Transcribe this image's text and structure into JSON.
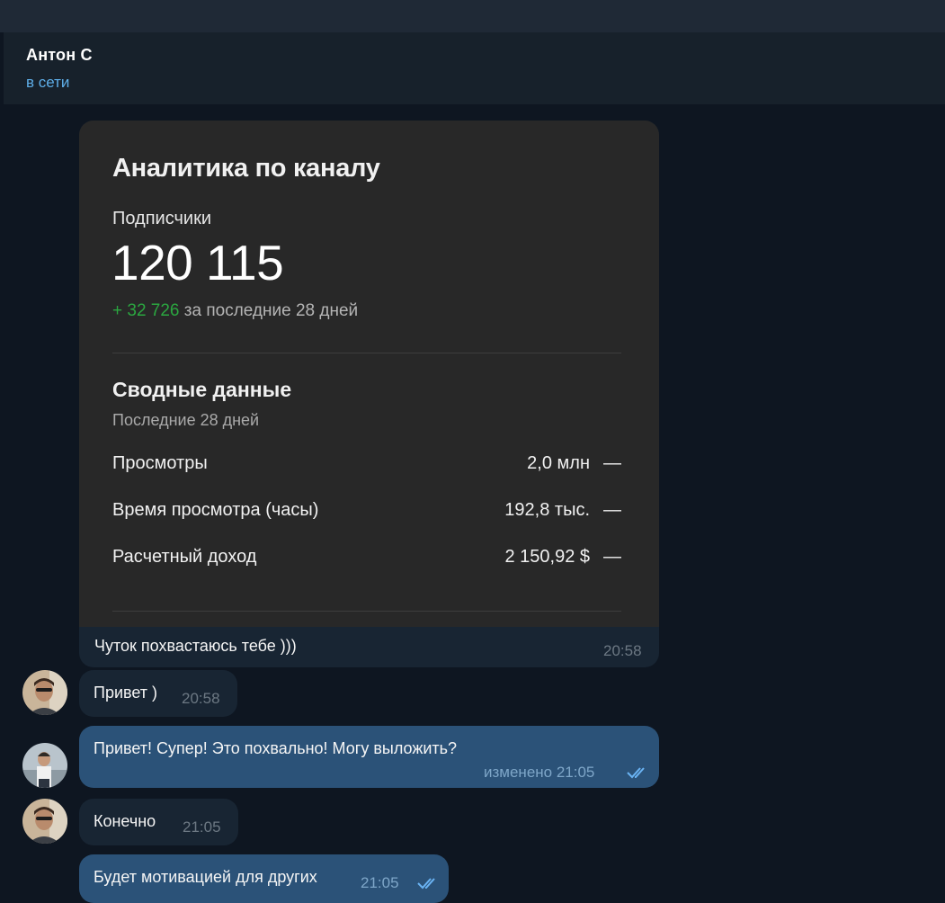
{
  "header": {
    "contact_name": "Антон С",
    "status": "в сети"
  },
  "analytics_card": {
    "title": "Аналитика по каналу",
    "subscribers_label": "Подписчики",
    "subscribers_value": "120 115",
    "growth_value": "+ 32 726",
    "growth_suffix": "за последние 28 дней",
    "summary_title": "Сводные данные",
    "summary_period": "Последние 28 дней",
    "rows": [
      {
        "label": "Просмотры",
        "value": "2,0 млн",
        "trend": "—"
      },
      {
        "label": "Время просмотра (часы)",
        "value": "192,8 тыс.",
        "trend": "—"
      },
      {
        "label": "Расчетный доход",
        "value": "2 150,92 $",
        "trend": "—"
      }
    ],
    "caption": "Чуток похвастаюсь тебе )))",
    "time": "20:58"
  },
  "messages": [
    {
      "text": "Привет )",
      "time": "20:58",
      "direction": "in"
    },
    {
      "text": "Привет! Супер! Это похвально! Могу выложить?",
      "time": "изменено 21:05",
      "direction": "out"
    },
    {
      "text": "Конечно",
      "time": "21:05",
      "direction": "in"
    },
    {
      "text": "Будет мотивацией для других",
      "time": "21:05",
      "direction": "out"
    }
  ],
  "colors": {
    "background": "#0e1621",
    "header": "#17212b",
    "incoming_bubble": "#182533",
    "outgoing_bubble": "#2b5278",
    "status_blue": "#5eaee8",
    "growth_green": "#2ba640"
  }
}
